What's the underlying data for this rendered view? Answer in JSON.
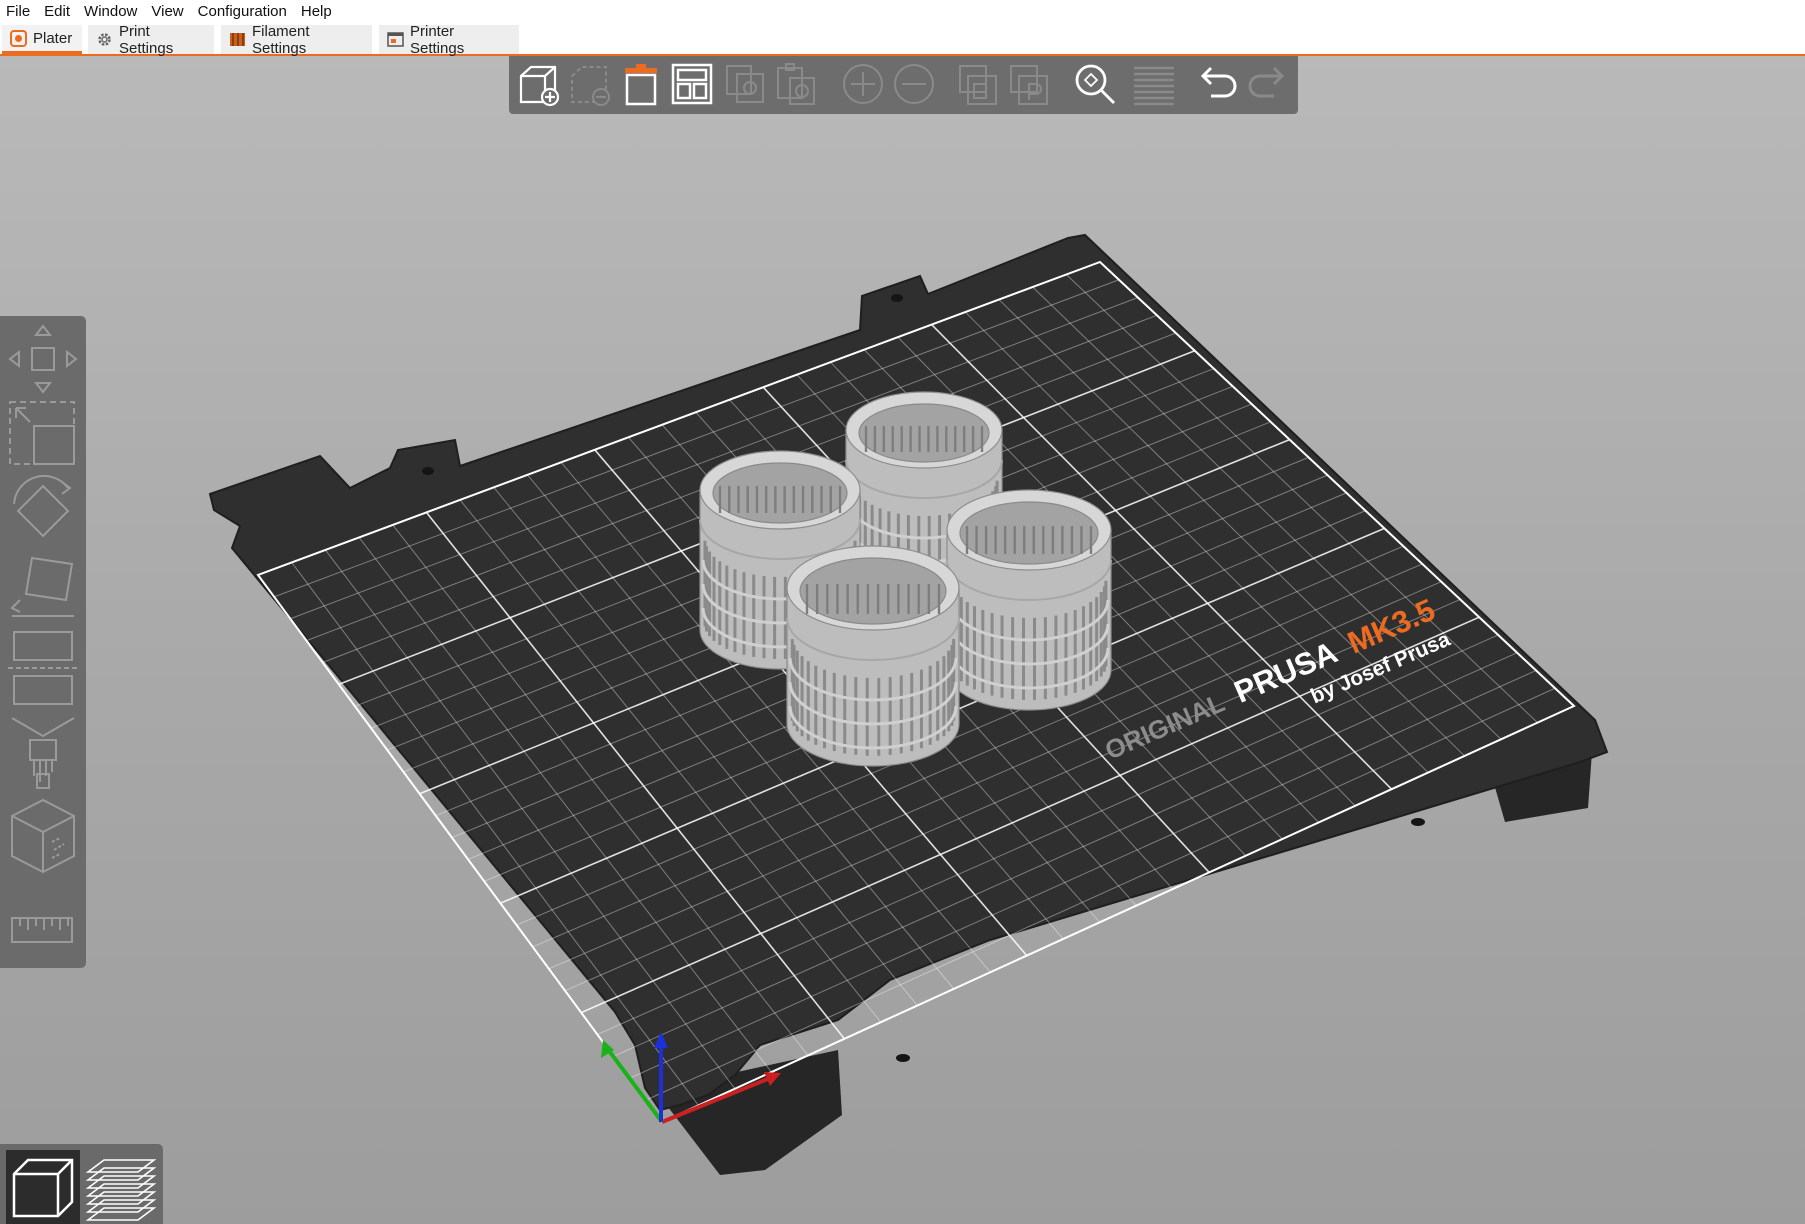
{
  "menu": [
    "File",
    "Edit",
    "Window",
    "View",
    "Configuration",
    "Help"
  ],
  "tabs": [
    {
      "label": "Plater",
      "icon": "plater-icon",
      "active": true
    },
    {
      "label": "Print Settings",
      "icon": "print-settings-gear-icon",
      "active": false
    },
    {
      "label": "Filament Settings",
      "icon": "filament-spool-icon",
      "active": false
    },
    {
      "label": "Printer Settings",
      "icon": "printer-settings-icon",
      "active": false
    }
  ],
  "toolbar": [
    {
      "name": "add-object",
      "icon": "add-object-icon",
      "enabled": true
    },
    {
      "name": "delete-object",
      "icon": "delete-object-icon",
      "enabled": false
    },
    {
      "name": "delete-all",
      "icon": "trash-icon",
      "enabled": true
    },
    {
      "name": "arrange",
      "icon": "arrange-icon",
      "enabled": true
    },
    {
      "name": "copy",
      "icon": "copy-icon",
      "enabled": false
    },
    {
      "name": "paste",
      "icon": "paste-icon",
      "enabled": false
    },
    {
      "name": "add-instance",
      "icon": "add-instance-icon",
      "enabled": false
    },
    {
      "name": "remove-instance",
      "icon": "remove-instance-icon",
      "enabled": false
    },
    {
      "name": "split-objects",
      "icon": "split-objects-icon",
      "enabled": false
    },
    {
      "name": "split-parts",
      "icon": "split-parts-icon",
      "enabled": false
    },
    {
      "name": "search",
      "icon": "search-icon",
      "enabled": true
    },
    {
      "name": "layers-editing",
      "icon": "layers-editing-icon",
      "enabled": false
    },
    {
      "name": "undo",
      "icon": "undo-icon",
      "enabled": true
    },
    {
      "name": "redo",
      "icon": "redo-icon",
      "enabled": false
    }
  ],
  "side_tools": [
    "move-icon",
    "scale-icon",
    "rotate-icon",
    "place-on-face-icon",
    "cut-icon",
    "paint-supports-icon",
    "seam-painting-icon",
    "measure-icon"
  ],
  "view_modes": [
    {
      "name": "3d-view",
      "icon": "cube-view-icon",
      "active": true
    },
    {
      "name": "preview",
      "icon": "layers-preview-icon",
      "active": false
    }
  ],
  "bed": {
    "brand_prefix": "ORIGINAL",
    "brand_name": "PRUSA",
    "model": "MK3.5",
    "byline": "by Josef Prusa"
  },
  "objects_count": 4,
  "colors": {
    "accent": "#ed6b21",
    "toolbar": "#6d6d6d",
    "bed": "#2f2f2f",
    "x_axis": "#cc1f1f",
    "y_axis": "#19b219",
    "z_axis": "#1d2fd6"
  }
}
